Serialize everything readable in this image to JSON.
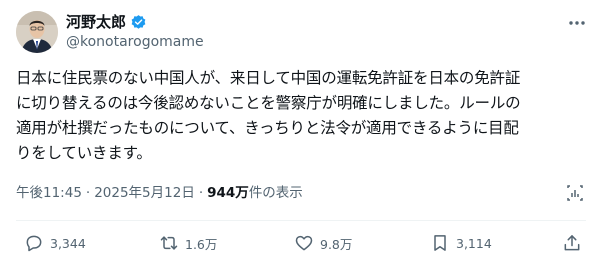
{
  "author": {
    "display_name": "河野太郎",
    "handle": "@konotarogomame",
    "verified": true
  },
  "tweet": {
    "text": "日本に住民票のない中国人が、来日して中国の運転免許証を日本の免許証\nに切り替えるのは今後認めないことを警察庁が明確にしました。ルールの\n適用が杜撰だったものについて、きっちりと法令が適用できるように目配\nりをしていきます。"
  },
  "meta": {
    "time": "午後11:45",
    "separator": "·",
    "date": "2025年5月12日",
    "views_count": "944万",
    "views_label": " 件の表示"
  },
  "actions": {
    "replies": "3,344",
    "reposts": "1.6万",
    "likes": "9.8万",
    "bookmarks": "3,114"
  },
  "colors": {
    "verified_blue": "#1d9bf0",
    "secondary_text": "#536471",
    "primary_text": "#0f1419"
  },
  "icons": {
    "verified": "verified-badge-icon",
    "more": "more-icon",
    "analytics": "analytics-icon",
    "reply": "reply-icon",
    "repost": "repost-icon",
    "like": "heart-icon",
    "views": "bookmark-icon",
    "share": "share-icon"
  }
}
